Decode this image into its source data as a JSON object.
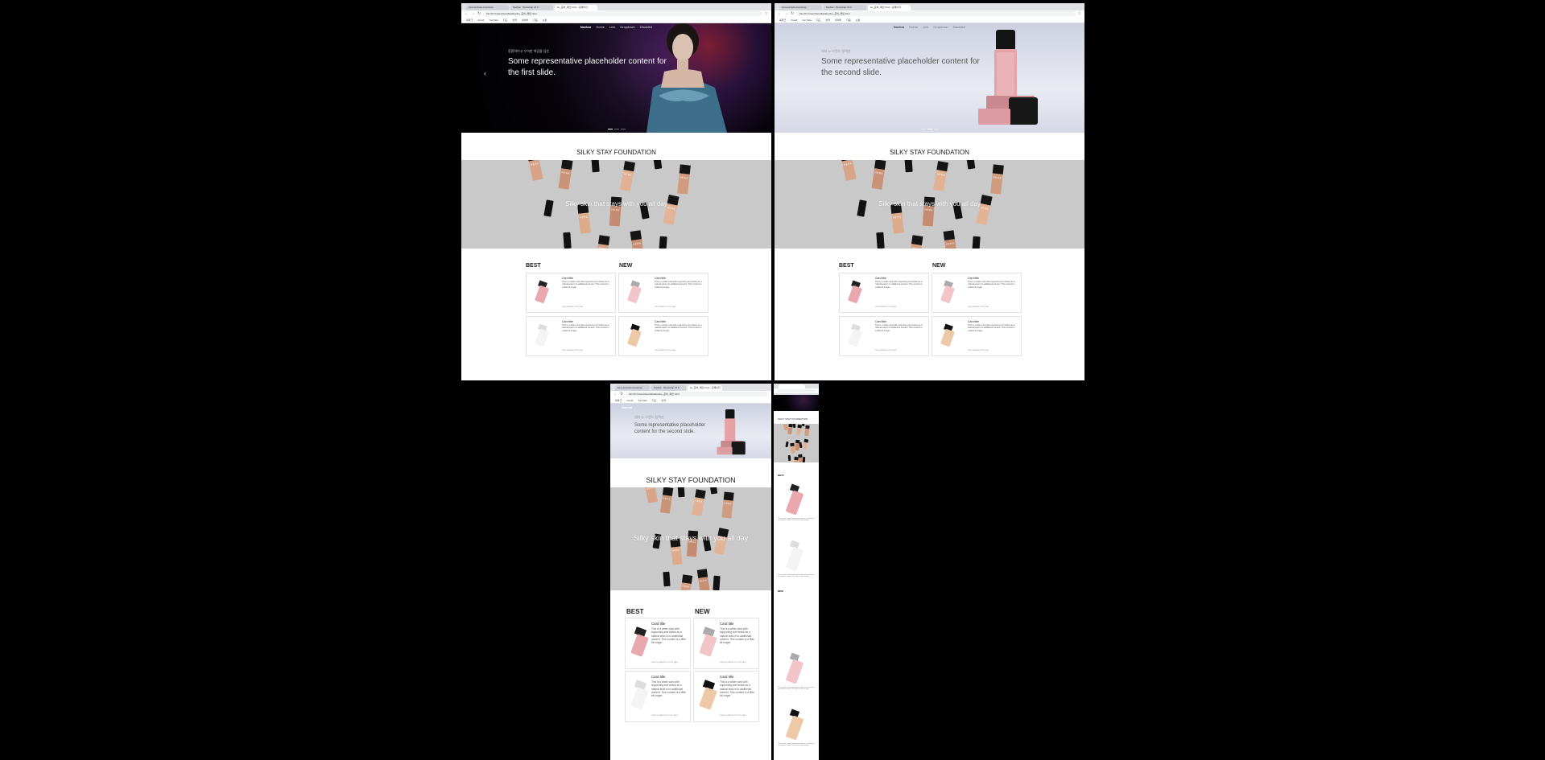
{
  "browser": {
    "tabs": [
      "hera-website-bootstrap",
      "Navbar · Bootstrap v5.0",
      "ko_준비_메인.html - 홈페이지"
    ],
    "url": "file:///C:/Users/hera/Desktop/ko_준비_메인.html",
    "bookmarks": [
      "북마크",
      "Gmail",
      "YouTube",
      "지도",
      "번역",
      "네이버",
      "다음",
      "쇼핑",
      "뉴스",
      "카카오"
    ]
  },
  "navbar": {
    "brand": "Navbar",
    "links": [
      "Home",
      "Link",
      "Dropdown",
      "Disabled"
    ]
  },
  "carousel": {
    "slide1": {
      "small": "몽환적이고 우아한 색감을 담은",
      "caption": "Some representative placeholder content for the first slide."
    },
    "slide2": {
      "small": "헤라 뉴 브랜드 컬렉션",
      "caption": "Some representative placeholder content for the second slide."
    },
    "prev_arrow": "‹"
  },
  "section": {
    "title": "SILKY STAY FOUNDATION",
    "banner_text": "Silky skin that stays with you all day",
    "brand_mark": "HERA"
  },
  "columns": {
    "best": "BEST",
    "new": "NEW"
  },
  "card": {
    "title": "Card title",
    "text": "This is a wider card with supporting text below as a natural lead-in to additional content. This content is a little bit longer.",
    "meta": "Last updated 3 mins ago"
  },
  "colors": {
    "hero_dark": "#050308",
    "hero_light": "#e1e4ee",
    "banner_bg": "#c9c9c9",
    "foundation": "#d8a488",
    "lipstick": "#e5a2a7"
  }
}
